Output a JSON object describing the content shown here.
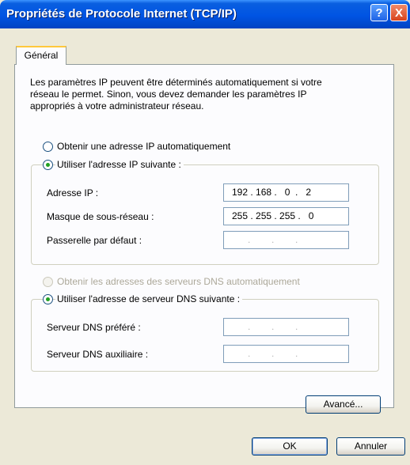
{
  "window": {
    "title": "Propriétés de Protocole Internet (TCP/IP)",
    "help_label": "?",
    "close_label": "X"
  },
  "tabs": [
    {
      "label": "Général",
      "selected": true
    }
  ],
  "general": {
    "description_lines": [
      "Les paramètres IP peuvent être déterminés automatiquement si votre",
      "réseau le permet. Sinon, vous devez demander les paramètres IP",
      "appropriés à votre administrateur réseau."
    ],
    "ip_auto": {
      "label": "Obtenir une adresse IP automatiquement",
      "selected": false
    },
    "ip_manual": {
      "label": "Utiliser l'adresse IP suivante :",
      "selected": true
    },
    "ip_fields": [
      {
        "label": "Adresse IP :",
        "value": "192 . 168 .   0  .   2"
      },
      {
        "label": "Masque de sous-réseau :",
        "value": "255 . 255 . 255 .   0"
      },
      {
        "label": "Passerelle par défaut :",
        "value": "      .        .        .   "
      }
    ],
    "dns_auto": {
      "label": "Obtenir les adresses des serveurs DNS automatiquement",
      "selected": false,
      "disabled": true
    },
    "dns_manual": {
      "label": "Utiliser l'adresse de serveur DNS suivante :",
      "selected": true
    },
    "dns_fields": [
      {
        "label": "Serveur DNS préféré :",
        "value": "      .        .        .   "
      },
      {
        "label": "Serveur DNS auxiliaire :",
        "value": "      .        .        .   "
      }
    ],
    "advanced_label": "Avancé..."
  },
  "buttons": {
    "ok": "OK",
    "cancel": "Annuler"
  },
  "colors": {
    "title_bar": "#0054e3",
    "dialog_bg": "#ece9d8",
    "tab_highlight": "#ffc83c",
    "radio_dot": "#21a121"
  }
}
